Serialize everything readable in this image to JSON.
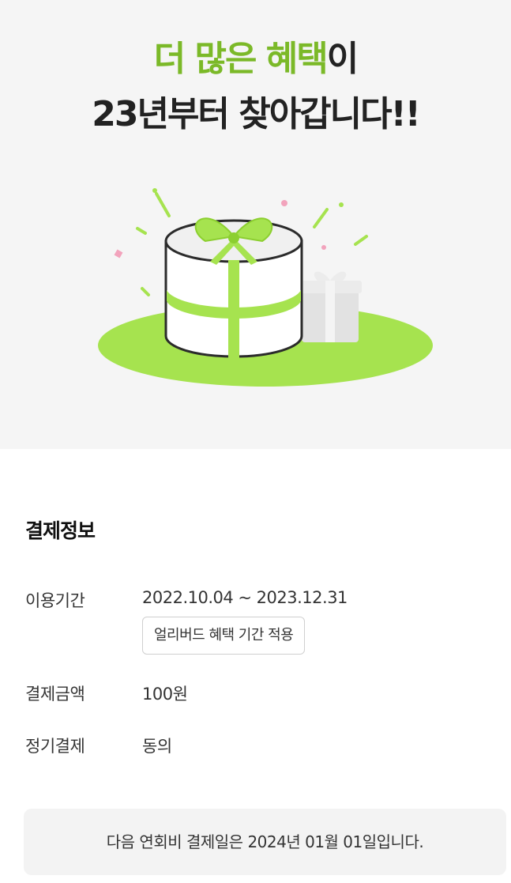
{
  "hero": {
    "title_accent": "더 많은 혜택",
    "title_suffix": "이",
    "title_line2": "23년부터 찾아갑니다!!"
  },
  "colors": {
    "accent": "#7bb928",
    "gift_green": "#a6e34f",
    "background": "#f5f5f5"
  },
  "payment_info": {
    "title": "결제정보",
    "period_label": "이용기간",
    "period_value": "2022.10.04 ~ 2023.12.31",
    "earlybird_badge": "얼리버드 혜택 기간 적용",
    "amount_label": "결제금액",
    "amount_value": "100원",
    "subscription_label": "정기결제",
    "subscription_value": "동의"
  },
  "notice": "다음 연회비 결제일은 2024년 01월 01일입니다."
}
